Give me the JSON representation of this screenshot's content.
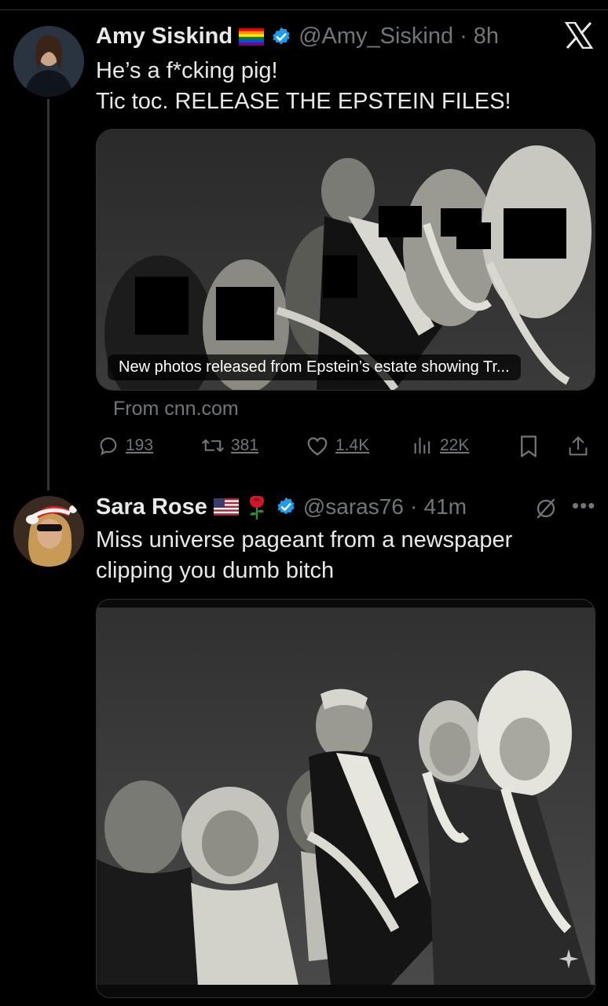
{
  "tweet1": {
    "name": "Amy Siskind",
    "handle": "@Amy_Siskind",
    "time": "8h",
    "line1": "He’s a f*cking pig!",
    "line2": "Tic toc. RELEASE THE EPSTEIN FILES!",
    "media_caption": "New photos released from Epstein’s estate showing Tr...",
    "source": "From cnn.com",
    "stats": {
      "replies": "193",
      "reposts": "381",
      "likes": "1.4K",
      "views": "22K"
    }
  },
  "tweet2": {
    "name": "Sara Rose",
    "handle": "@saras76",
    "time": "41m",
    "line1": "Miss universe pageant from a newspaper",
    "line2": "clipping you dumb bitch"
  },
  "colors": {
    "background": "#000000",
    "text": "#e7e9ea",
    "muted": "#71767b",
    "verified": "#1d9bf0",
    "border": "#2f3336"
  },
  "icons": [
    "x-logo-icon",
    "verified-icon",
    "rainbow-flag-icon",
    "us-flag-icon",
    "rose-icon",
    "reply-icon",
    "repost-icon",
    "like-icon",
    "views-icon",
    "bookmark-icon",
    "share-icon",
    "grok-icon",
    "more-icon"
  ]
}
